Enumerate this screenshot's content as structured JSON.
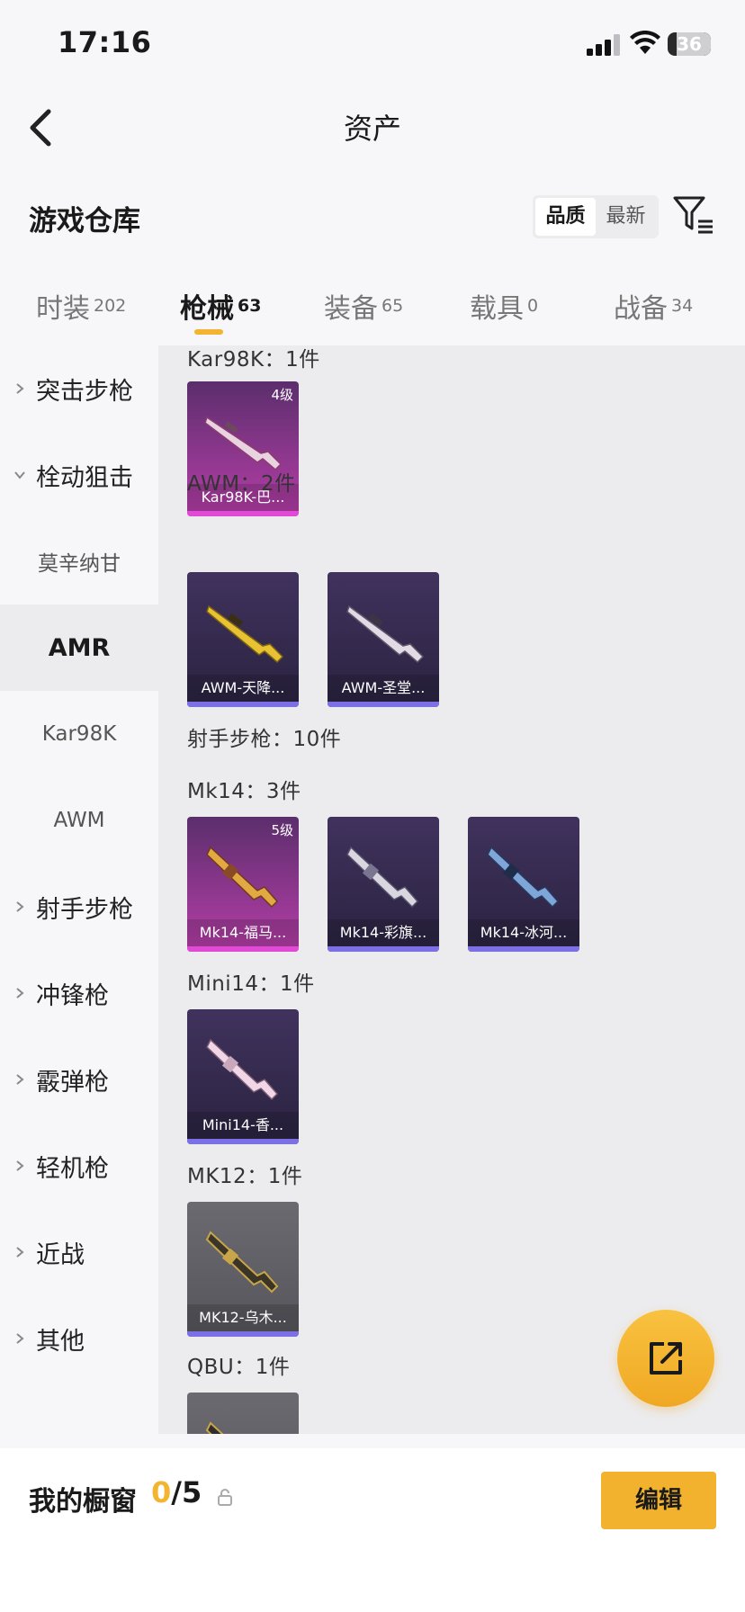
{
  "status_bar": {
    "time": "17:16",
    "battery": "36"
  },
  "nav": {
    "title": "资产"
  },
  "warehouse": {
    "title": "游戏仓库",
    "sort_options": [
      "品质",
      "最新"
    ]
  },
  "tabs": [
    {
      "label": "时装",
      "count": "202"
    },
    {
      "label": "枪械",
      "count": "63"
    },
    {
      "label": "装备",
      "count": "65"
    },
    {
      "label": "载具",
      "count": "0"
    },
    {
      "label": "战备",
      "count": "34"
    }
  ],
  "sidebar": [
    {
      "label": "突击步枪"
    },
    {
      "label": "栓动狙击"
    },
    {
      "label": "莫辛纳甘"
    },
    {
      "label": "AMR"
    },
    {
      "label": "Kar98K"
    },
    {
      "label": "AWM"
    },
    {
      "label": "射手步枪"
    },
    {
      "label": "冲锋枪"
    },
    {
      "label": "霰弹枪"
    },
    {
      "label": "轻机枪"
    },
    {
      "label": "近战"
    },
    {
      "label": "其他"
    }
  ],
  "groups": [
    {
      "title": "Kar98K：1件",
      "items": [
        {
          "name": "Kar98K-巴...",
          "level": "4级",
          "rarity": "pink"
        }
      ]
    },
    {
      "title": "AWM：2件",
      "items": [
        {
          "name": "AWM-天降...",
          "rarity": "purple"
        },
        {
          "name": "AWM-圣堂...",
          "rarity": "purple"
        }
      ]
    },
    {
      "title": "射手步枪：10件",
      "items": []
    },
    {
      "title": "Mk14：3件",
      "items": [
        {
          "name": "Mk14-福马...",
          "level": "5级",
          "rarity": "pink"
        },
        {
          "name": "Mk14-彩旗...",
          "rarity": "purple"
        },
        {
          "name": "Mk14-冰河...",
          "rarity": "purple"
        }
      ]
    },
    {
      "title": "Mini14：1件",
      "items": [
        {
          "name": "Mini14-香...",
          "rarity": "purple"
        }
      ]
    },
    {
      "title": "MK12：1件",
      "items": [
        {
          "name": "MK12-乌木...",
          "rarity": "gray"
        }
      ]
    },
    {
      "title": "QBU：1件",
      "items": []
    }
  ],
  "bottom": {
    "window_label": "我的橱窗",
    "window_current": "0",
    "window_total": "/5",
    "edit_label": "编辑"
  },
  "colors": {
    "accent": "#f3b431",
    "rarity_purple": "#7d6fe6",
    "rarity_pink": "#e14ad5"
  }
}
